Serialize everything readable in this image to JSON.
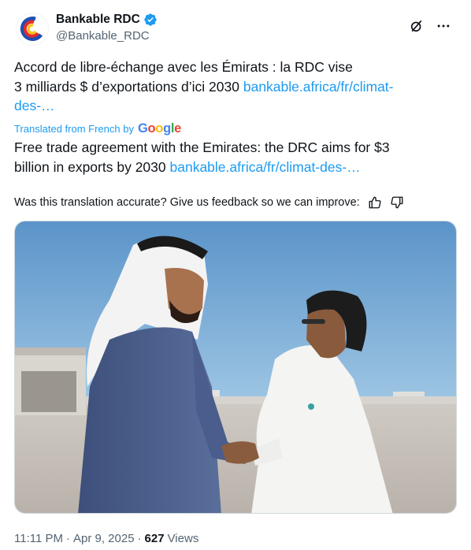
{
  "author": {
    "display_name": "Bankable RDC",
    "handle": "@Bankable_RDC",
    "verified": true,
    "verified_color": "#1d9bf0",
    "avatar_icon": "bankable-logo-icon"
  },
  "header_actions": {
    "grok_icon": "grok-icon",
    "more_icon": "more-options-icon"
  },
  "original": {
    "text_line1": "Accord de libre-échange avec les Émirats : la RDC vise",
    "text_line2": "3 milliards $ d’exportations d’ici 2030",
    "link_part1": "bankable.africa/fr/climat-",
    "link_part2": "des-…"
  },
  "translation": {
    "translated_from": "Translated from French by",
    "provider": "Google",
    "text_part1": "Free trade agreement with the Emirates: the DRC aims for $3",
    "text_part2": "billion in exports by 2030",
    "link": "bankable.africa/fr/climat-des-…"
  },
  "feedback": {
    "prompt": "Was this translation accurate? Give us feedback so we can improve:",
    "thumbs_up_icon": "thumbs-up-icon",
    "thumbs_down_icon": "thumbs-down-icon"
  },
  "media": {
    "type": "photo"
  },
  "meta": {
    "time": "11:11 PM",
    "separator": "·",
    "date": "Apr 9, 2025",
    "views_count": "627",
    "views_label": "Views"
  },
  "colors": {
    "link": "#1d9bf0",
    "secondary_text": "#536471",
    "primary_text": "#0f1419",
    "border": "#cfd9de"
  }
}
